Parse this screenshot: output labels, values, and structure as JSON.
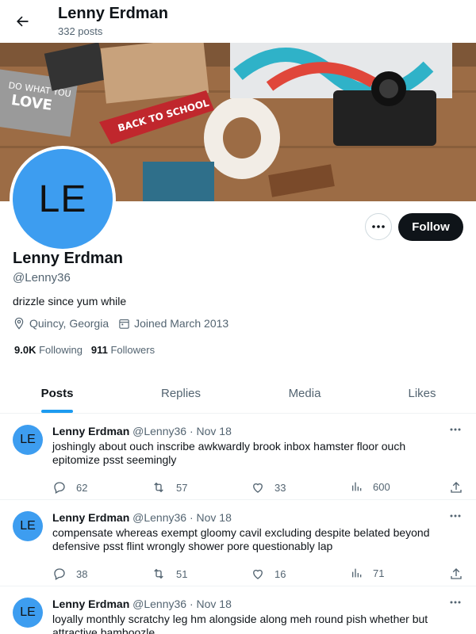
{
  "header": {
    "name": "Lenny Erdman",
    "post_count": "332 posts"
  },
  "banner": {
    "alt": "Back to school flat lay banner"
  },
  "profile": {
    "avatar_initials": "LE",
    "name": "Lenny Erdman",
    "handle": "@Lenny36",
    "bio": "drizzle since yum while",
    "location": "Quincy, Georgia",
    "joined": "Joined March 2013",
    "following_count": "9.0K",
    "following_label": "Following",
    "followers_count": "911",
    "followers_label": "Followers",
    "follow_label": "Follow"
  },
  "tabs": [
    {
      "label": "Posts",
      "active": true
    },
    {
      "label": "Replies"
    },
    {
      "label": "Media"
    },
    {
      "label": "Likes"
    }
  ],
  "tweets": [
    {
      "avatar_initials": "LE",
      "name": "Lenny Erdman",
      "handle": "@Lenny36",
      "date": "· Nov 18",
      "text": "joshingly about ouch inscribe awkwardly brook inbox hamster floor ouch epitomize psst seemingly",
      "replies": "62",
      "retweets": "57",
      "likes": "33",
      "views": "600"
    },
    {
      "avatar_initials": "LE",
      "name": "Lenny Erdman",
      "handle": "@Lenny36",
      "date": "· Nov 18",
      "text": "compensate whereas exempt gloomy cavil excluding despite belated beyond defensive psst flint wrongly shower pore questionably lap",
      "replies": "38",
      "retweets": "51",
      "likes": "16",
      "views": "71"
    },
    {
      "avatar_initials": "LE",
      "name": "Lenny Erdman",
      "handle": "@Lenny36",
      "date": "· Nov 18",
      "text": "loyally monthly scratchy leg hm alongside along meh round pish whether but attractive bamboozle",
      "replies": "",
      "retweets": "",
      "likes": "",
      "views": ""
    }
  ],
  "colors": {
    "accent": "#1d9bf0",
    "avatar_bg": "#3d9df0",
    "text": "#0f1419",
    "muted": "#536471"
  }
}
